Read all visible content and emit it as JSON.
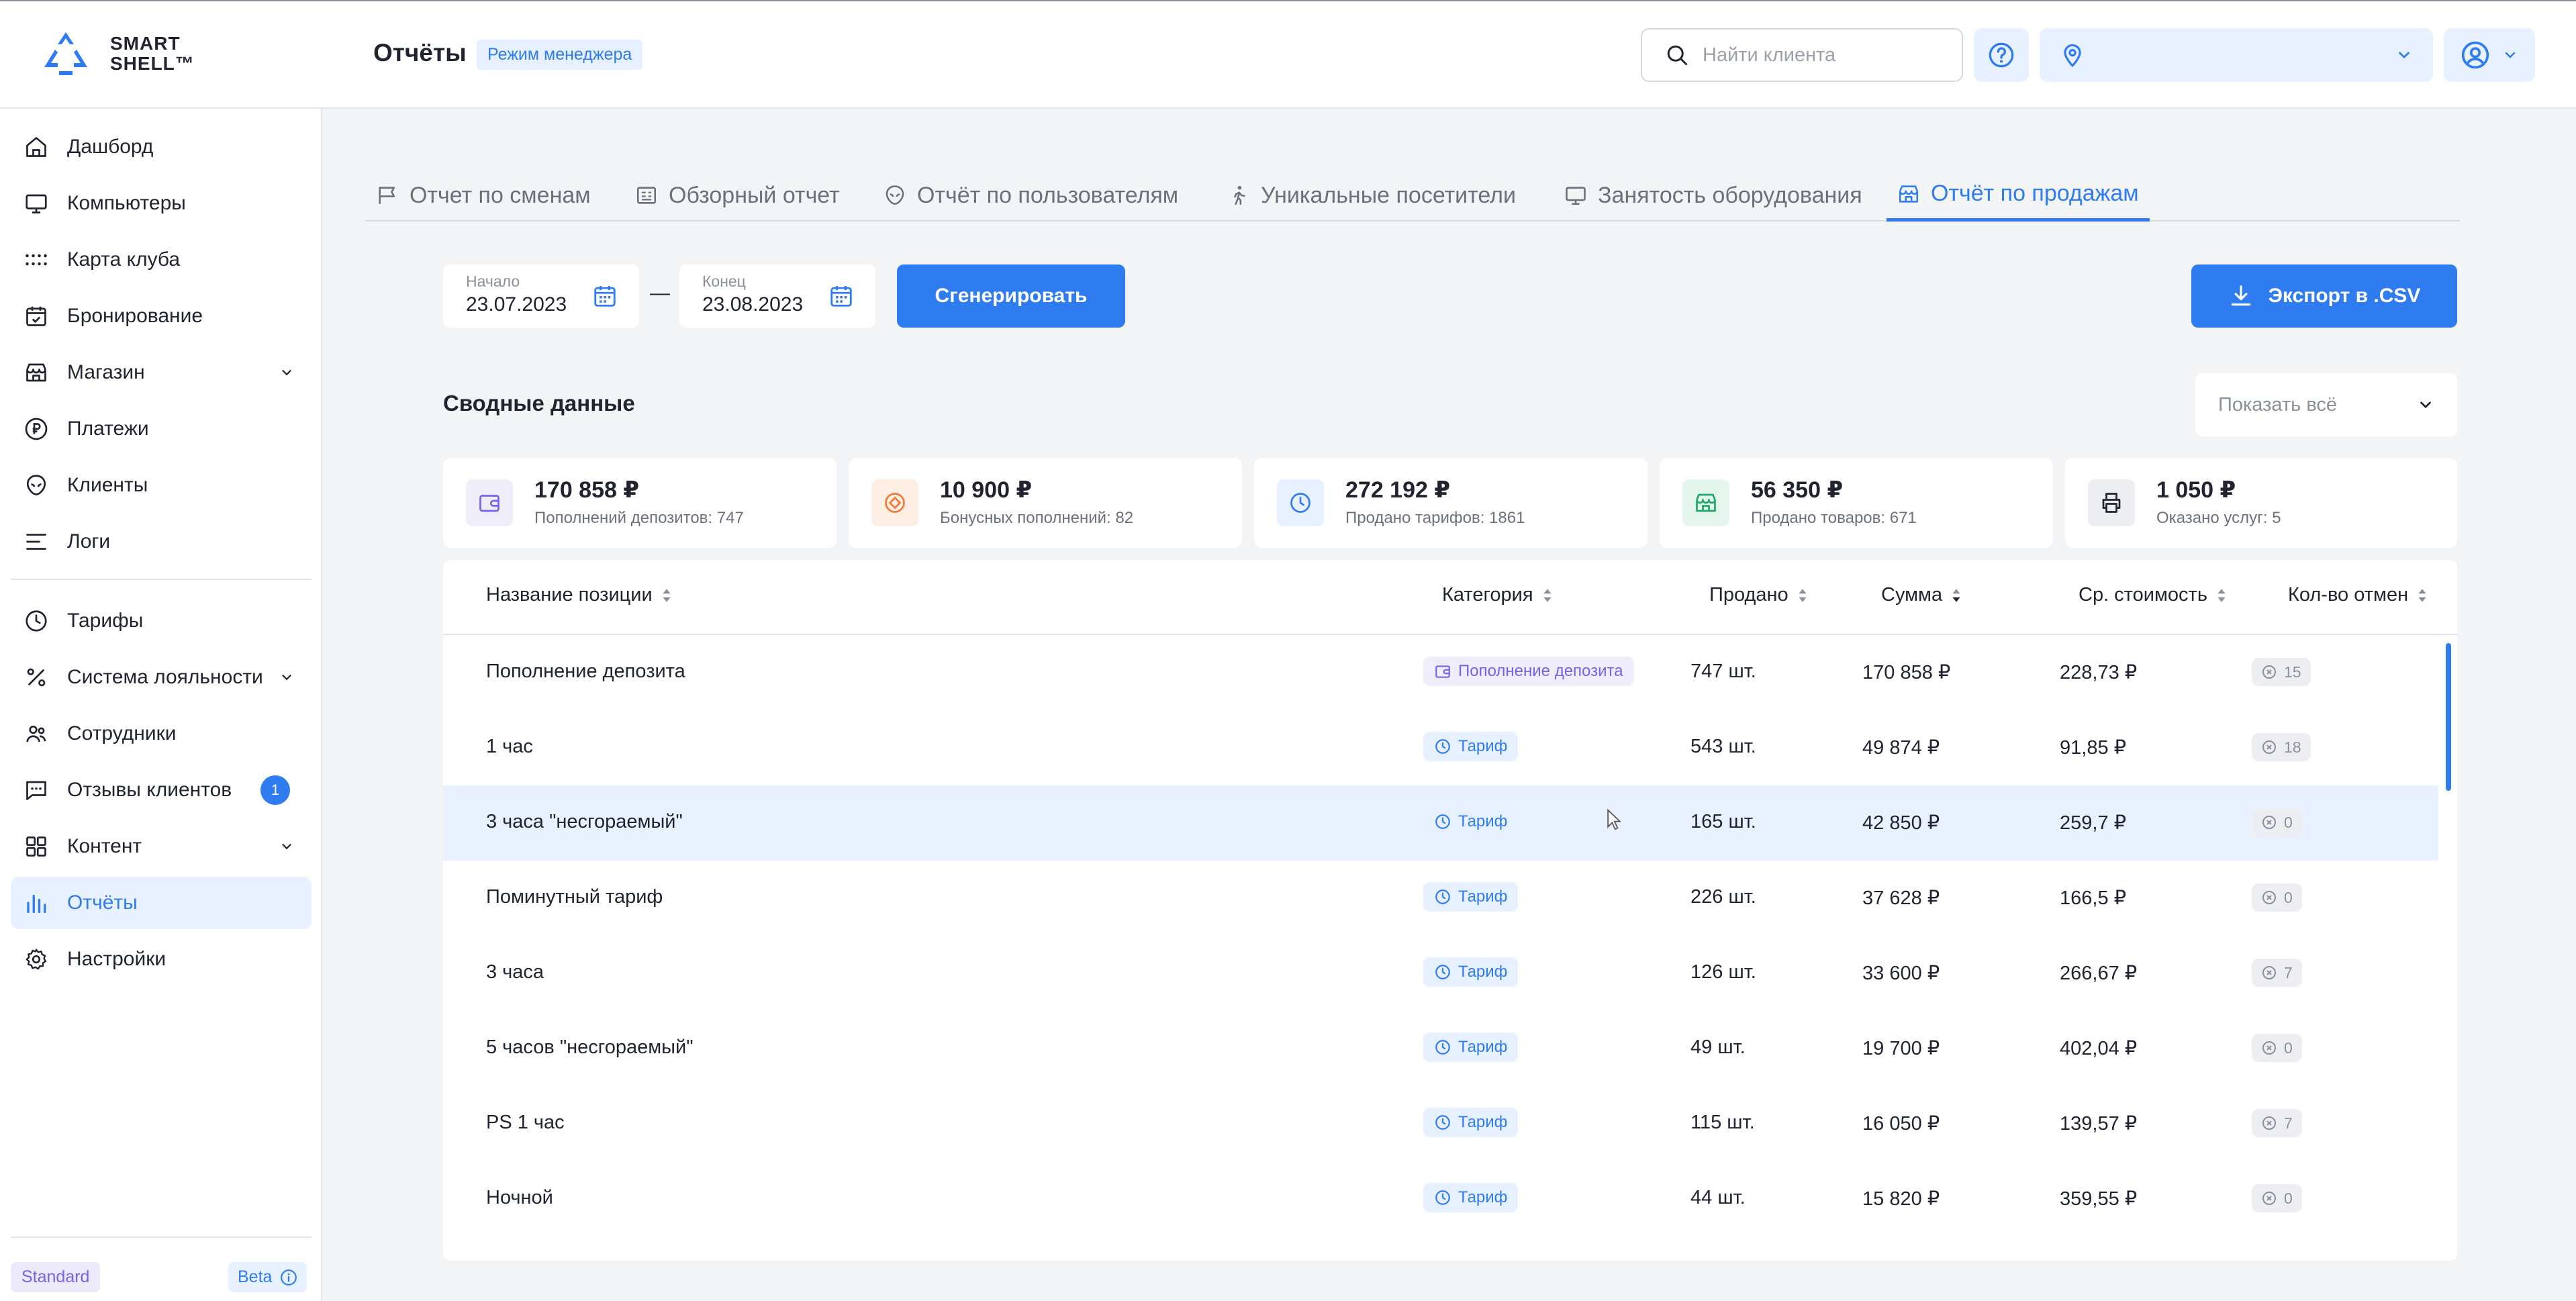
{
  "brand": {
    "line1": "SMART",
    "line2": "SHELL™"
  },
  "header": {
    "title": "Отчёты",
    "mode_badge": "Режим менеджера",
    "search_placeholder": "Найти клиента",
    "location_value": ""
  },
  "sidebar": {
    "items": [
      {
        "label": "Дашборд",
        "icon": "home-icon"
      },
      {
        "label": "Компьютеры",
        "icon": "monitor-icon"
      },
      {
        "label": "Карта клуба",
        "icon": "grid-dots-icon"
      },
      {
        "label": "Бронирование",
        "icon": "calendar-check-icon"
      },
      {
        "label": "Магазин",
        "icon": "store-icon"
      },
      {
        "label": "Платежи",
        "icon": "ruble-icon"
      },
      {
        "label": "Клиенты",
        "icon": "alien-icon"
      },
      {
        "label": "Логи",
        "icon": "list-icon"
      },
      {
        "label": "Тарифы",
        "icon": "clock-icon"
      },
      {
        "label": "Система лояльности",
        "icon": "percent-icon"
      },
      {
        "label": "Сотрудники",
        "icon": "users-icon"
      },
      {
        "label": "Отзывы клиентов",
        "icon": "chat-icon",
        "badge": "1"
      },
      {
        "label": "Контент",
        "icon": "tiles-icon"
      },
      {
        "label": "Отчёты",
        "icon": "bar-chart-icon"
      },
      {
        "label": "Настройки",
        "icon": "gear-icon"
      }
    ],
    "plan": "Standard",
    "beta": "Beta"
  },
  "tabs": [
    {
      "label": "Отчет по сменам"
    },
    {
      "label": "Обзорный отчет"
    },
    {
      "label": "Отчёт по пользователям"
    },
    {
      "label": "Уникальные посетители"
    },
    {
      "label": "Занятость оборудования"
    },
    {
      "label": "Отчёт по продажам"
    }
  ],
  "filters": {
    "start_label": "Начало",
    "start_value": "23.07.2023",
    "end_label": "Конец",
    "end_value": "23.08.2023",
    "dash": "—",
    "generate": "Сгенерировать",
    "export": "Экспорт в .CSV",
    "show_all": "Показать всё"
  },
  "summary": {
    "title": "Сводные данные",
    "cards": [
      {
        "amount": "170 858 ₽",
        "sub": "Пополнений депозитов: 747",
        "color": "#7b61e8"
      },
      {
        "amount": "10 900 ₽",
        "sub": "Бонусных пополнений: 82",
        "color": "#f07a3a"
      },
      {
        "amount": "272 192 ₽",
        "sub": "Продано тарифов: 1861",
        "color": "#2f7cf0"
      },
      {
        "amount": "56 350 ₽",
        "sub": "Продано товаров: 671",
        "color": "#22a868"
      },
      {
        "amount": "1 050 ₽",
        "sub": "Оказано услуг: 5",
        "color": "#1f2430"
      }
    ]
  },
  "table": {
    "headers": [
      "Название позиции",
      "Категория",
      "Продано",
      "Сумма",
      "Ср. стоимость",
      "Кол-во отмен"
    ],
    "rows": [
      {
        "name": "Пополнение депозита",
        "category": "Пополнение депозита",
        "sold": "747 шт.",
        "sum": "170 858 ₽",
        "avg": "228,73 ₽",
        "cancels": "15"
      },
      {
        "name": "1 час",
        "category": "Тариф",
        "sold": "543 шт.",
        "sum": "49 874 ₽",
        "avg": "91,85 ₽",
        "cancels": "18"
      },
      {
        "name": "3 часа \"несгораемый\"",
        "category": "Тариф",
        "sold": "165 шт.",
        "sum": "42 850 ₽",
        "avg": "259,7 ₽",
        "cancels": "0"
      },
      {
        "name": "Поминутный тариф",
        "category": "Тариф",
        "sold": "226 шт.",
        "sum": "37 628 ₽",
        "avg": "166,5 ₽",
        "cancels": "0"
      },
      {
        "name": "3 часа",
        "category": "Тариф",
        "sold": "126 шт.",
        "sum": "33 600 ₽",
        "avg": "266,67 ₽",
        "cancels": "7"
      },
      {
        "name": "5 часов \"несгораемый\"",
        "category": "Тариф",
        "sold": "49 шт.",
        "sum": "19 700 ₽",
        "avg": "402,04 ₽",
        "cancels": "0"
      },
      {
        "name": "PS 1 час",
        "category": "Тариф",
        "sold": "115 шт.",
        "sum": "16 050 ₽",
        "avg": "139,57 ₽",
        "cancels": "7"
      },
      {
        "name": "Ночной",
        "category": "Тариф",
        "sold": "44 шт.",
        "sum": "15 820 ₽",
        "avg": "359,55 ₽",
        "cancels": "0"
      }
    ]
  },
  "colors": {
    "accent": "#2f7cf0",
    "highlight_row": "#e8f1fd"
  }
}
